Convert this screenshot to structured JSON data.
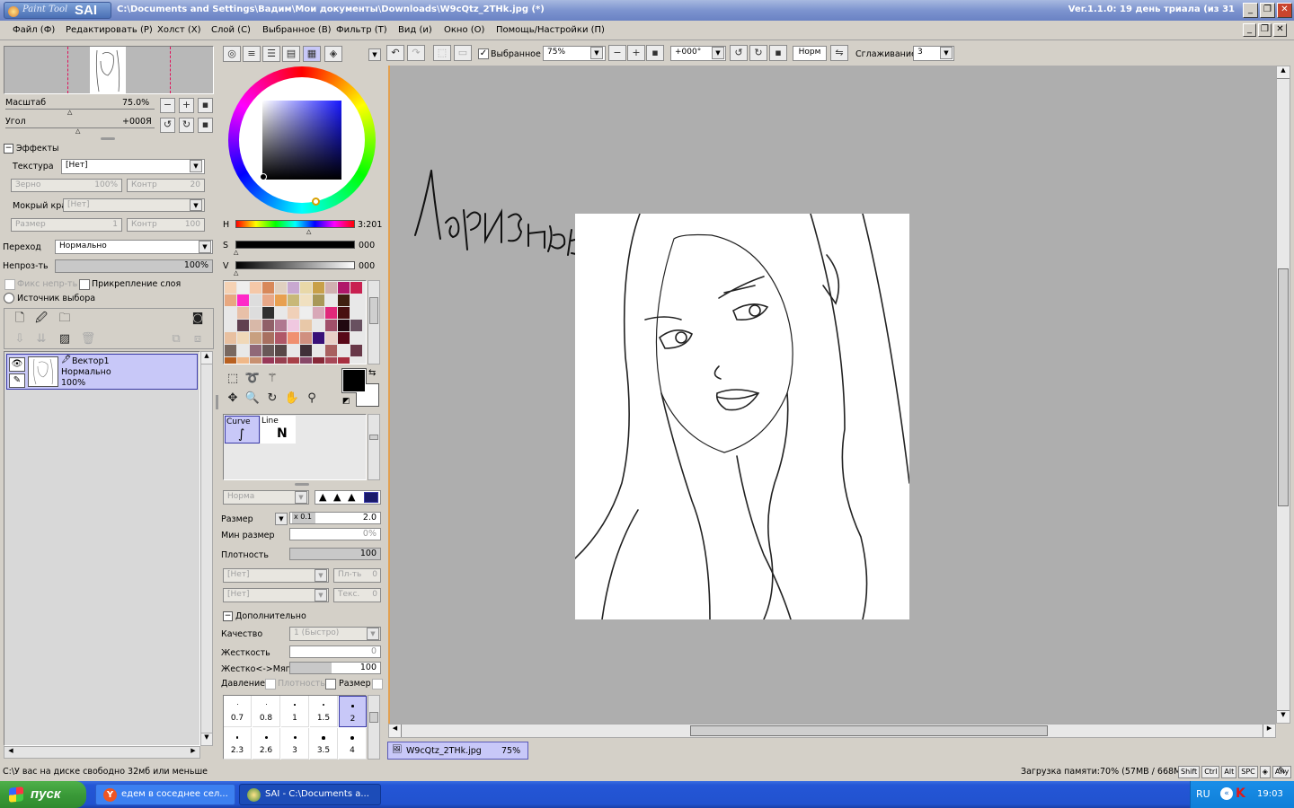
{
  "titlebar": {
    "app_logo_text": "Paint Tool",
    "app_logo_big": "SAI",
    "title": "C:\\Documents and Settings\\Вадим\\Мои документы\\Downloads\\W9cQtz_2THk.jpg (*)",
    "version": "Ver.1.1.0: 19 день триала (из 31"
  },
  "menu": {
    "items": [
      "Файл (Ф)",
      "Редактировать (Р)",
      "Холст (Х)",
      "Слой (С)",
      "Выбранное (В)",
      "Фильтр (Т)",
      "Вид (и)",
      "Окно (О)",
      "Помощь/Настройки (П)"
    ]
  },
  "navigator": {
    "scale_label": "Масштаб",
    "scale_value": "75.0%",
    "angle_label": "Угол",
    "angle_value": "+000Я"
  },
  "effects": {
    "header": "Эффекты",
    "texture_label": "Текстура",
    "texture_value": "[Нет]",
    "grain_label": "Зерно",
    "grain_value": "100%",
    "contrast_label": "Контр",
    "contrast_value": "20",
    "wet_edge_label": "Мокрый край",
    "wet_edge_value": "[Нет]",
    "size_label": "Размер",
    "size_value": "1",
    "contrast2_label": "Контр",
    "contrast2_value": "100"
  },
  "layer_props": {
    "blend_label": "Переход",
    "blend_value": "Нормально",
    "opacity_label": "Непроз-ть",
    "opacity_value": "100%",
    "preserve_opacity": "Фикс непр-ть",
    "clip_layer": "Прикрепление слоя",
    "selection_source": "Источник выбора"
  },
  "layers": [
    {
      "name": "Вектор1",
      "mode": "Нормально",
      "opacity": "100%"
    }
  ],
  "color": {
    "h_label": "H",
    "h_value": "3:201",
    "s_label": "S",
    "s_value": "000",
    "v_label": "V",
    "v_value": "000",
    "swatches": [
      "#f5d2b4",
      "#eeeeee",
      "#f5c8a8",
      "#d8885a",
      "#e0d0c0",
      "#c8a8d0",
      "#e8d8a8",
      "#c8a048",
      "#d0b0b0",
      "#b0186a",
      "#c82050",
      "#e8a880",
      "#ff28c8",
      "#dddddd",
      "#e8a888",
      "#e8a050",
      "#c8b878",
      "#f0e0c0",
      "#a89858",
      "#e8e8e8",
      "#402010",
      "#e8e8e8",
      "#e8e8e8",
      "#e8c0a8",
      "#dddddd",
      "#303030",
      "#e8e8e8",
      "#f0d0b8",
      "#eeeeee",
      "#d8a8b8",
      "#e0287a",
      "#481010",
      "#e8e8e8",
      "#e8e8e8",
      "#604050",
      "#d8b8a8",
      "#906068",
      "#b07890",
      "#f0c8e0",
      "#e8c8a8",
      "#e8e8e8",
      "#a0506a",
      "#200810",
      "#685060",
      "#e8c0a0",
      "#f0d8b8",
      "#c8a080",
      "#a87060",
      "#b05868",
      "#f09070",
      "#d09080",
      "#381078",
      "#e8d0c8",
      "#580818",
      "#e8e8e8",
      "#786860",
      "#e8e8e8",
      "#906878",
      "#685858",
      "#584848",
      "#e8e8e8",
      "#403038",
      "#e8e8e8",
      "#a86060",
      "#e8e8e8",
      "#683848",
      "#b86020",
      "#f0b888",
      "#c89070",
      "#983858",
      "#984050",
      "#a84048",
      "#884868",
      "#882838",
      "#a84858",
      "#a83040",
      "#e8e8e8"
    ]
  },
  "tools": {
    "curve": "Curve",
    "line": "Line"
  },
  "brush": {
    "mode_value": "Норма",
    "size_label": "Размер",
    "size_mult": "x 0.1",
    "size_value": "2.0",
    "min_size_label": "Мин размер",
    "min_size_value": "0%",
    "density_label": "Плотность",
    "density_value": "100",
    "shape1_value": "[Нет]",
    "shape1_side_label": "Пл-ть",
    "shape1_side_value": "0",
    "shape2_value": "[Нет]",
    "shape2_side_label": "Текс.",
    "shape2_side_value": "0",
    "advanced_header": "Дополнительно",
    "quality_label": "Качество",
    "quality_value": "1 (Быстро)",
    "hardness_label": "Жесткость",
    "hardness_value": "0",
    "hard_soft_label": "Жестко<->Мягко",
    "hard_soft_value": "100",
    "pressure_label": "Давление:",
    "pressure_density": "Плотность",
    "pressure_size": "Размер",
    "sizes_row1": [
      "0.7",
      "0.8",
      "1",
      "1.5",
      "2"
    ],
    "sizes_row2": [
      "2.3",
      "2.6",
      "3",
      "3.5",
      "4"
    ]
  },
  "toolbar": {
    "selection_label": "Выбранное",
    "zoom_value": "75%",
    "angle_value": "+000°",
    "blend_value": "Норм",
    "smoothing_label": "Сглаживание",
    "smoothing_value": "3"
  },
  "canvas": {
    "handwriting": "Лагризль"
  },
  "doc_tab": {
    "name": "W9cQtz_2THk.jpg",
    "zoom": "75%"
  },
  "statusbar": {
    "left": "C:\\У вас на диске свободно 32мб или меньше",
    "memory": "Загрузка памяти:70% (57MB / 668MB)",
    "keys": [
      "Shift",
      "Ctrl",
      "Alt",
      "SPC",
      "◈",
      "Any"
    ]
  },
  "taskbar": {
    "start": "пуск",
    "tasks": [
      "едем в соседнее сел...",
      "SAI - C:\\Documents a..."
    ],
    "lang": "RU",
    "clock": "19:03"
  },
  "colors": {
    "titlebar": "#7d94cf",
    "canvas_bg": "#aeaeae",
    "layer_selected": "#c8c8f8",
    "taskbar": "#2456d6",
    "start": "#3a9a38"
  }
}
